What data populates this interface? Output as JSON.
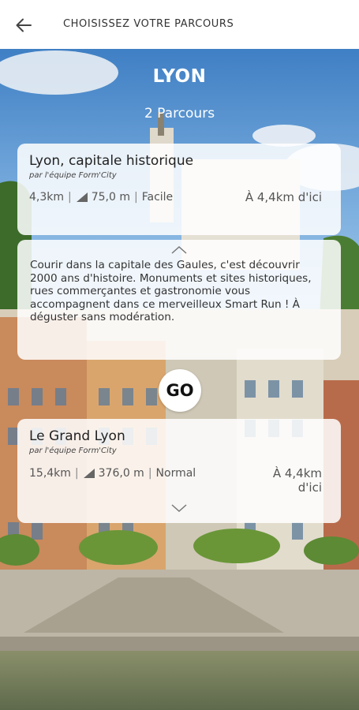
{
  "header": {
    "title": "CHOISISSEZ VOTRE PARCOURS"
  },
  "hero": {
    "city": "LYON",
    "route_count": "2 Parcours"
  },
  "routes": [
    {
      "name": "Lyon, capitale historique",
      "author": "par l'équipe Form'City",
      "distance": "4,3km",
      "elevation": "75,0 m",
      "difficulty": "Facile",
      "distance_from_user": "À 4,4km d'ici"
    },
    {
      "name": "Le Grand Lyon",
      "author": "par l'équipe Form'City",
      "distance": "15,4km",
      "elevation": "376,0 m",
      "difficulty": "Normal",
      "distance_from_user_line1": "À 4,4km",
      "distance_from_user_line2": "d'ici"
    }
  ],
  "description": "Courir dans la capitale des Gaules, c'est découvrir 2000 ans d'histoire. Monuments et sites historiques, rues commerçantes et gastronomie vous accompagnent dans ce merveilleux Smart Run ! À déguster sans modération.",
  "go_button": "GO",
  "separator": "|"
}
